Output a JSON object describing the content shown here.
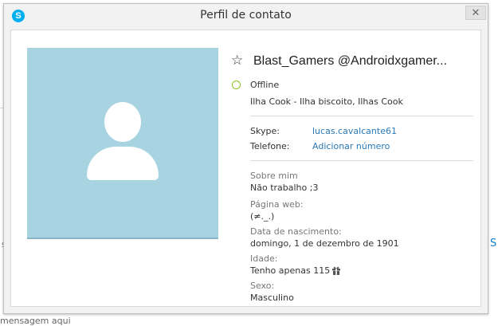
{
  "window": {
    "title": "Perfil de contato",
    "app_icon_glyph": "S",
    "close_glyph": "✕"
  },
  "profile": {
    "name": "Blast_Gamers @Androidxgamer...",
    "status": "Offline",
    "location": "Ilha Cook - Ilha biscoito, Ilhas Cook",
    "skype_label": "Skype:",
    "skype_value": "lucas.cavalcante61",
    "phone_label": "Telefone:",
    "phone_value": "Adicionar número",
    "about_label": "Sobre mim",
    "about_value": "Não trabalho ;3",
    "web_label": "Página web:",
    "web_value": "(≠._.)",
    "birth_label": "Data de nascimento:",
    "birth_value": "domingo, 1 de dezembro de 1901",
    "age_label": "Idade:",
    "age_value": "Tenho apenas 115",
    "sex_label": "Sexo:",
    "sex_value": "Masculino"
  },
  "background": {
    "left_fragment": "s",
    "right_fragment": "S",
    "bottom_fragment": "mensagem aqui"
  },
  "colors": {
    "accent_link": "#2a79b8",
    "status_offline": "#8fc31f",
    "avatar_bg": "#a8d3e0",
    "skype_blue": "#00aff0"
  },
  "icons": {
    "star": "star-icon",
    "status": "status-offline-icon",
    "gift": "gift-icon",
    "close": "close-icon"
  }
}
